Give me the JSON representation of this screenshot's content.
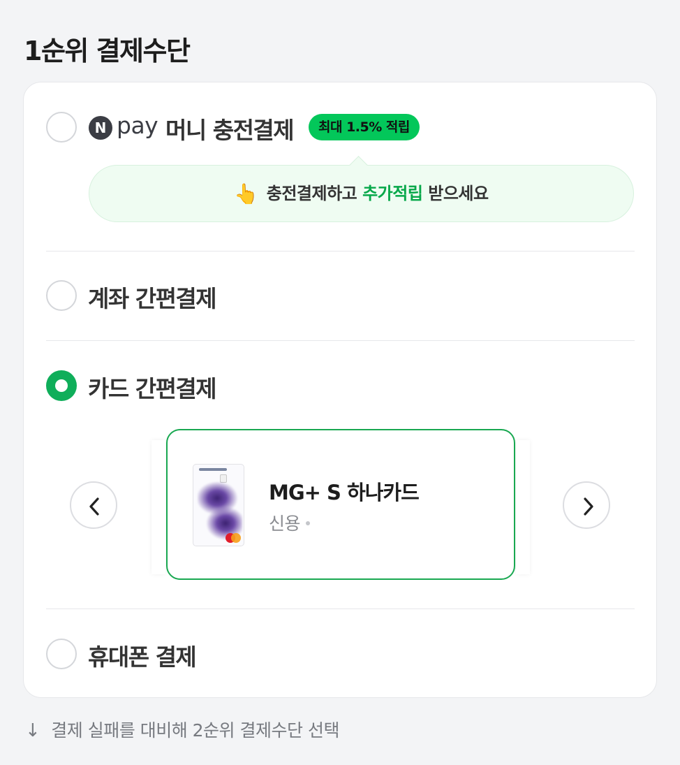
{
  "title": "1순위 결제수단",
  "options": {
    "npay": {
      "logo_letter": "N",
      "brand": "pay",
      "label": "머니 충전결제",
      "badge": "최대 1.5% 적립",
      "tip": {
        "emoji": "👆",
        "pre": "충전결제하고 ",
        "highlight": "추가적립",
        "post": " 받으세요"
      },
      "selected": false
    },
    "account": {
      "label": "계좌 간편결제",
      "selected": false
    },
    "card": {
      "label": "카드 간편결제",
      "selected": true,
      "card_name": "MG+ S 하나카드",
      "card_type": "신용"
    },
    "phone": {
      "label": "휴대폰 결제",
      "selected": false
    }
  },
  "footer": {
    "arrow": "↓",
    "text": "결제 실패를 대비해 2순위 결제수단 선택"
  },
  "colors": {
    "accent_green": "#03c75a",
    "selected_green": "#0fae5a",
    "highlight_green": "#07a84a"
  },
  "icons": {
    "prev": "chevron-left-icon",
    "next": "chevron-right-icon",
    "tip": "pointing-hand-icon",
    "card_brand": "mastercard-icon"
  }
}
